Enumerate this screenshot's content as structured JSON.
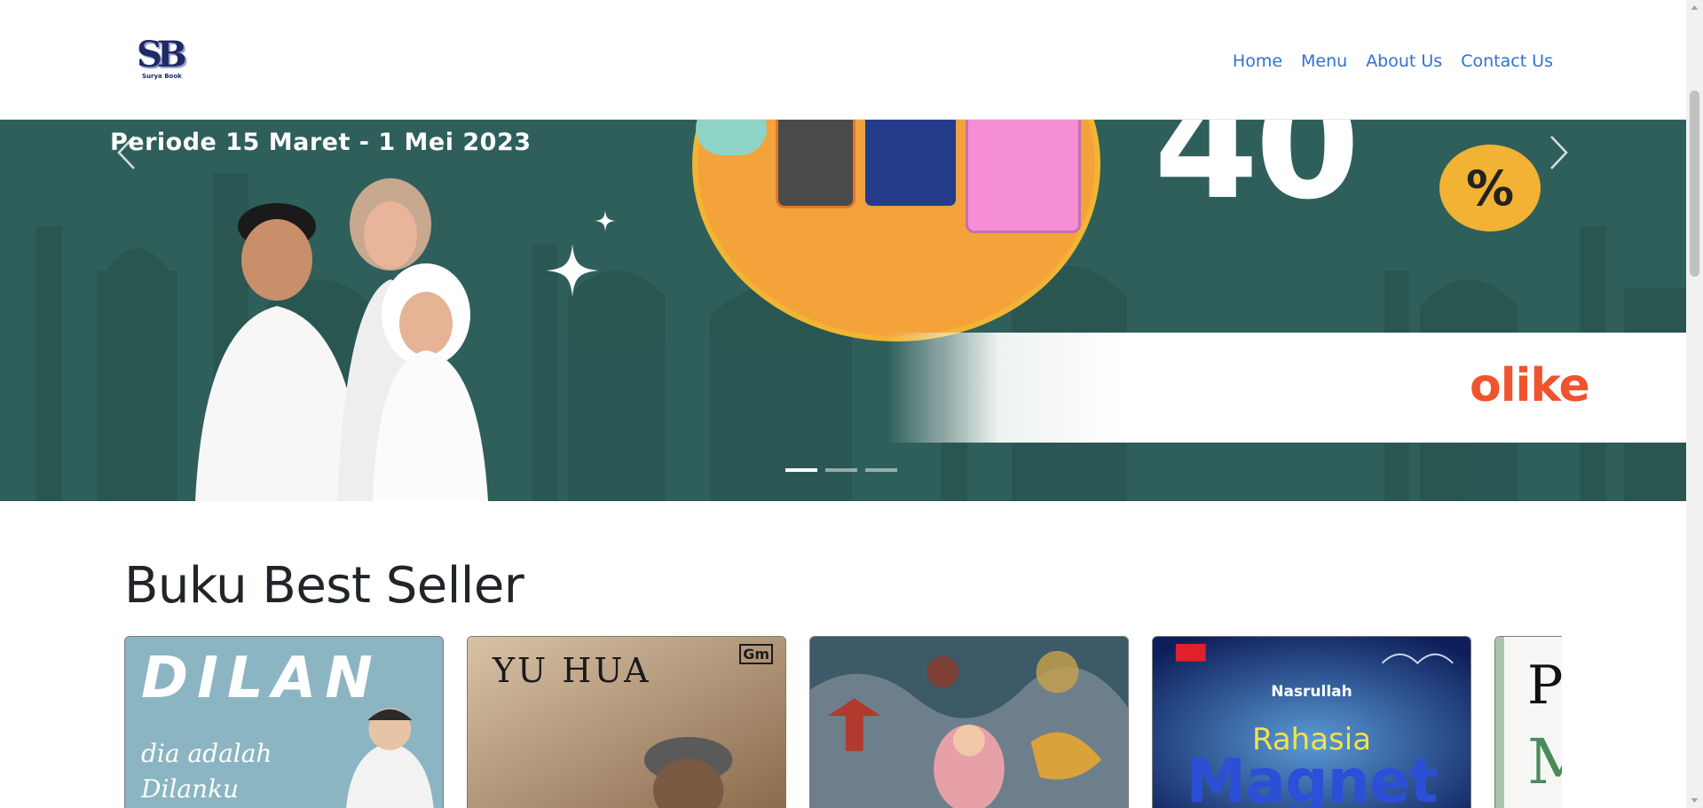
{
  "brand": {
    "logo_mark": "SB",
    "logo_sub": "Surya Book"
  },
  "nav": {
    "items": [
      {
        "label": "Home"
      },
      {
        "label": "Menu"
      },
      {
        "label": "About Us"
      },
      {
        "label": "Contact Us"
      }
    ]
  },
  "banner": {
    "period": "Periode 15 Maret - 1 Mei 2023",
    "discount_number": "40",
    "discount_symbol": "%",
    "brand": "olike",
    "active_slide": 1,
    "slide_count": 3
  },
  "section": {
    "title": "Buku Best Seller"
  },
  "books": [
    {
      "cover_title": "DILAN",
      "cover_sub": "dia adalah Dilanku"
    },
    {
      "cover_title": "YU HUA",
      "publisher": "Gm"
    },
    {
      "cover_title": ""
    },
    {
      "author": "Nasrullah",
      "cover_title": "Rahasia",
      "cover_title2": "Magnet"
    },
    {
      "cover_title": "P",
      "cover_title2": "M"
    }
  ],
  "colors": {
    "nav_link": "#3170d6",
    "banner_bg": "#2f5f5b",
    "accent": "#f2b233",
    "olike": "#f0532d"
  }
}
